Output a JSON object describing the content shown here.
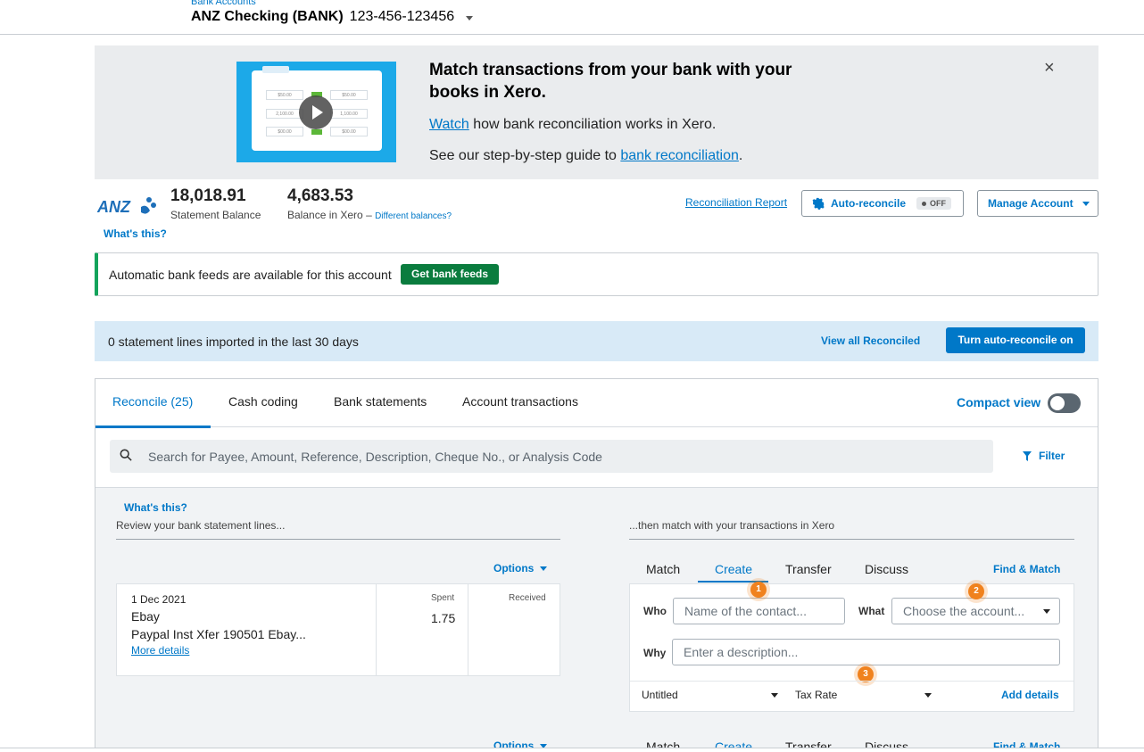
{
  "header": {
    "breadcrumb": "Bank Accounts",
    "account_name": "ANZ Checking (BANK)",
    "account_number": "123-456-123456"
  },
  "banner": {
    "title": "Match transactions from your bank with your books in Xero.",
    "watch_link": "Watch",
    "watch_text": " how bank reconciliation works in Xero.",
    "guide_text": "See our step-by-step guide to ",
    "guide_link": "bank reconciliation",
    "guide_end": ".",
    "close_icon": "×",
    "video_cells": [
      "$50.00",
      "$50.00",
      "2,100.00",
      "1,100.00",
      "$00.00",
      "$00.00"
    ]
  },
  "balances": {
    "statement_amount": "18,018.91",
    "statement_label": "Statement Balance",
    "xero_amount": "4,683.53",
    "xero_label": "Balance in Xero",
    "dash": " – ",
    "different_link": "Different balances?",
    "whats_this": "What's this?",
    "bank_logo": "ANZ"
  },
  "actions": {
    "reconciliation_report": "Reconciliation Report",
    "auto_reconcile": "Auto-reconcile",
    "off": "OFF",
    "manage_account": "Manage Account"
  },
  "feeds": {
    "text": "Automatic bank feeds are available for this account",
    "button": "Get bank feeds"
  },
  "info": {
    "text": "0 statement lines imported in the last 30 days",
    "view_all": "View all Reconciled",
    "turn_on": "Turn auto-reconcile on"
  },
  "tabs": [
    "Reconcile (25)",
    "Cash coding",
    "Bank statements",
    "Account transactions"
  ],
  "compact_view": "Compact view",
  "search": {
    "placeholder": "Search for Payee, Amount, Reference, Description, Cheque No., or Analysis Code"
  },
  "filter": "Filter",
  "work": {
    "whats_this": "What's this?",
    "review": "Review your bank statement lines...",
    "then_match": "...then match with your transactions in Xero",
    "options": "Options"
  },
  "statement_line": {
    "date": "1 Dec 2021",
    "payee": "Ebay",
    "description": "Paypal Inst Xfer 190501 Ebay...",
    "more_details": "More details",
    "spent_header": "Spent",
    "spent_value": "1.75",
    "received_header": "Received"
  },
  "match_tabs": [
    "Match",
    "Create",
    "Transfer",
    "Discuss"
  ],
  "find_match": "Find & Match",
  "create_form": {
    "who_label": "Who",
    "who_placeholder": "Name of the contact...",
    "what_label": "What",
    "what_placeholder": "Choose the account...",
    "why_label": "Why",
    "why_placeholder": "Enter a description...",
    "tracking": "Untitled",
    "tax_rate": "Tax Rate",
    "add_details": "Add details",
    "badges": [
      "1",
      "2",
      "3"
    ]
  }
}
